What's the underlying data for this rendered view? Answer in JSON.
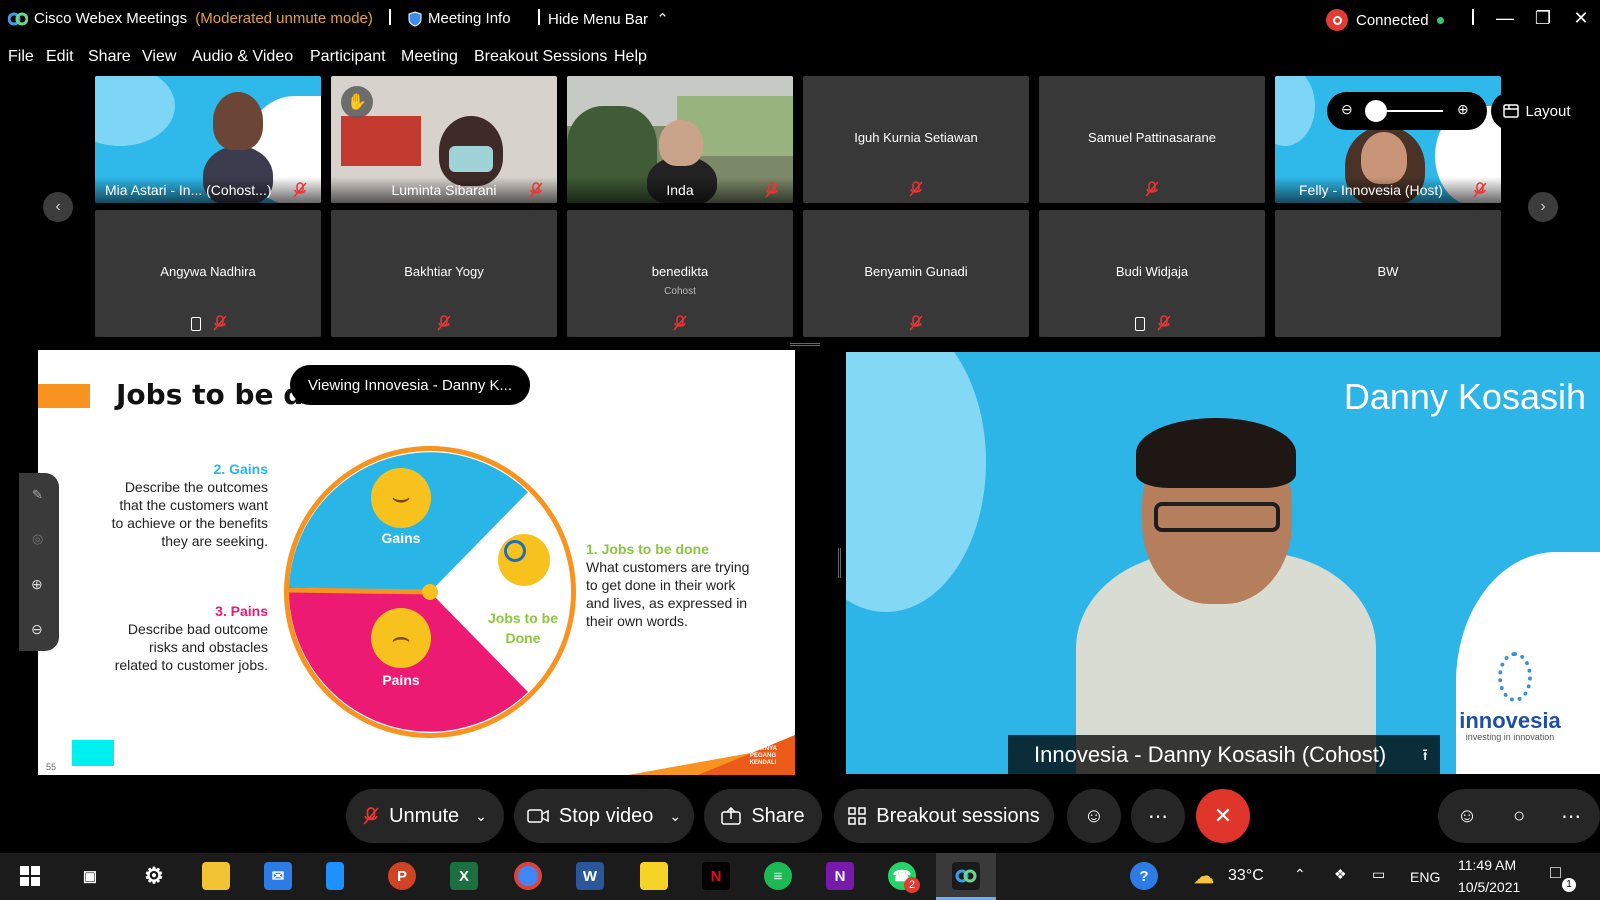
{
  "window": {
    "app_name": "Cisco Webex Meetings",
    "mode": "(Moderated unmute mode)",
    "meeting_info_label": "Meeting Info",
    "hide_menu_label": "Hide Menu Bar",
    "status": "Connected"
  },
  "menu": [
    "File",
    "Edit",
    "Share",
    "View",
    "Audio & Video",
    "Participant",
    "Meeting",
    "Breakout Sessions",
    "Help"
  ],
  "participants": {
    "row1": [
      {
        "label": "Mia Astari - In...",
        "role": "(Cohost...)"
      },
      {
        "label": "Luminta Sibarani"
      },
      {
        "label": "Inda"
      },
      {
        "label": "Iguh Kurnia Setiawan"
      },
      {
        "label": "Samuel Pattinasarane"
      },
      {
        "label": "Felly - Innovesia",
        "role": "(Host)"
      }
    ],
    "row2": [
      {
        "label": "Angywa Nadhira"
      },
      {
        "label": "Bakhtiar Yogy"
      },
      {
        "label": "benedikta",
        "role": "Cohost"
      },
      {
        "label": "Benyamin Gunadi"
      },
      {
        "label": "Budi Widjaja"
      },
      {
        "label": "BW"
      }
    ]
  },
  "layout_label": "Layout",
  "viewing_label": "Viewing Innovesia - Danny K...",
  "slide": {
    "title": "Jobs to be do",
    "gains_heading": "2. Gains",
    "gains_text": "Describe the outcomes that the customers want to achieve or the benefits they are seeking.",
    "pains_heading": "3. Pains",
    "pains_text": "Describe bad outcome risks and obstacles related to customer jobs.",
    "jobs_heading": "1. Jobs to be done",
    "jobs_text": "What customers are trying to get done in their work and lives, as expressed in their own words.",
    "wheel_gains": "Gains",
    "wheel_pains": "Pains",
    "wheel_jobs": "Jobs to be Done",
    "page_number": "55",
    "footer_tag": "SAATNYA PEGANG KENDALI"
  },
  "speaker": {
    "overlay_name": "Danny Kosasih",
    "banner_name": "Innovesia - Danny Kosasih  (Cohost)",
    "brand": "innovesia",
    "brand_tagline": "investing in innovation"
  },
  "controls": {
    "unmute": "Unmute",
    "stop_video": "Stop video",
    "share": "Share",
    "breakout": "Breakout sessions"
  },
  "taskbar": {
    "temperature": "33°C",
    "language": "ENG",
    "time": "11:49 AM",
    "date": "10/5/2021",
    "whatsapp_badge": "2",
    "notification_badge": "1"
  },
  "colors": {
    "slide_orange": "#f7931e",
    "slide_blue": "#29b6e6",
    "slide_pink": "#ec1a73",
    "slide_green": "#8cc63f",
    "speaker_bg": "#2eb5e8",
    "end_call_red": "#e0352b"
  }
}
